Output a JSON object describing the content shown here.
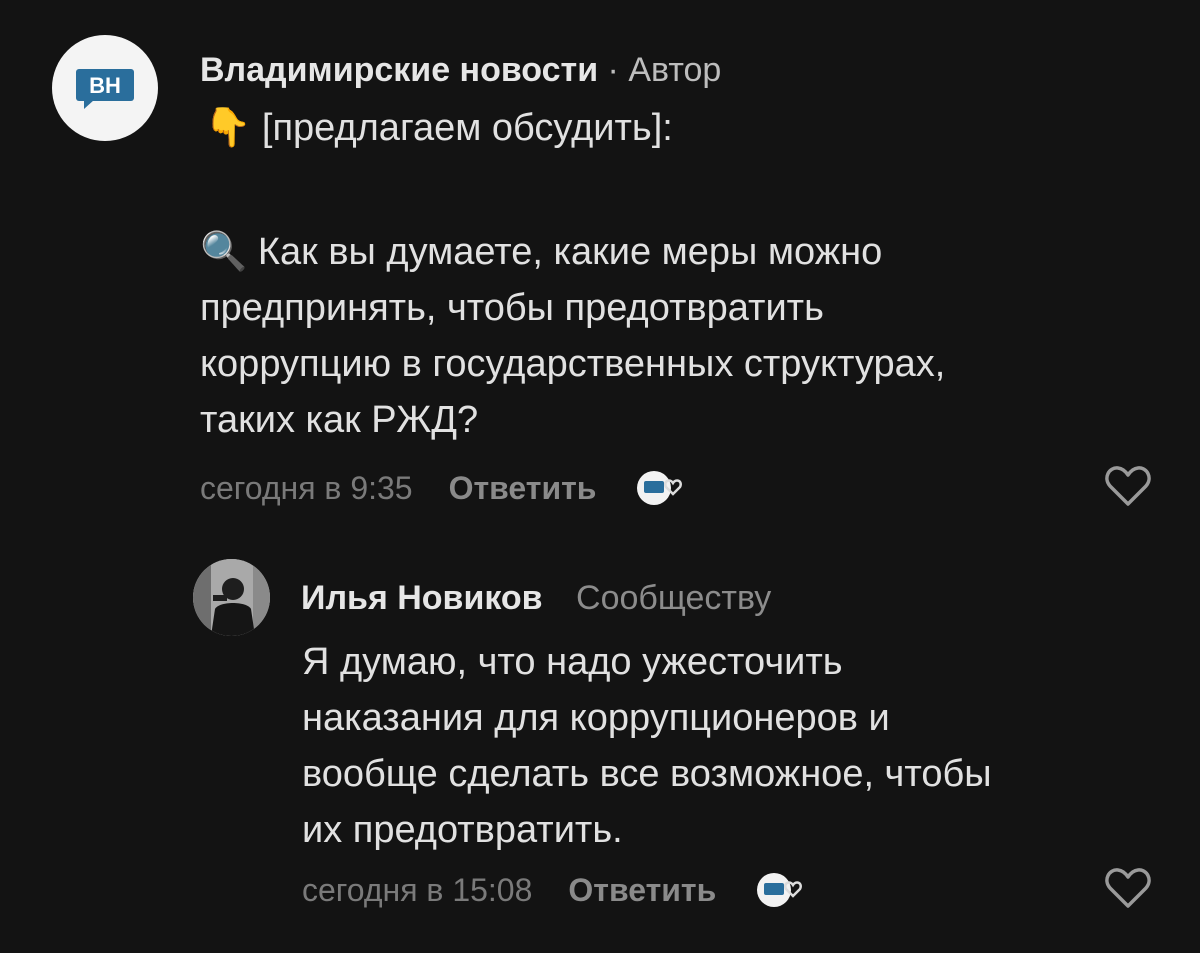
{
  "post_comment": {
    "avatar_text": "ВН",
    "author": "Владимирские новости",
    "separator": "·",
    "role": "Автор",
    "line1_text": "[предлагаем обсудить]:",
    "line1_emoji": "👇",
    "question_emoji": "🔍",
    "body_lines": [
      "Как вы думаете, какие меры можно",
      "предпринять, чтобы предотвратить",
      "коррупцию в государственных структурах,",
      "таких как РЖД?"
    ],
    "time": "сегодня в 9:35",
    "reply_label": "Ответить",
    "author_like_icon": "author-heart-badge-icon",
    "like_icon": "heart-outline-icon"
  },
  "reply_comment": {
    "author": "Илья Новиков",
    "role": "Сообществу",
    "body_lines": [
      "Я думаю, что надо ужесточить",
      "наказания для коррупционеров и",
      "вообще сделать все возможное, чтобы",
      "их предотвратить."
    ],
    "time": "сегодня в 15:08",
    "reply_label": "Ответить",
    "author_like_icon": "author-heart-badge-icon",
    "like_icon": "heart-outline-icon"
  },
  "colors": {
    "background": "#131313",
    "logo_blue": "#2a6e9c",
    "text_primary": "#e1e1e1",
    "text_secondary": "#7a7a7a"
  }
}
